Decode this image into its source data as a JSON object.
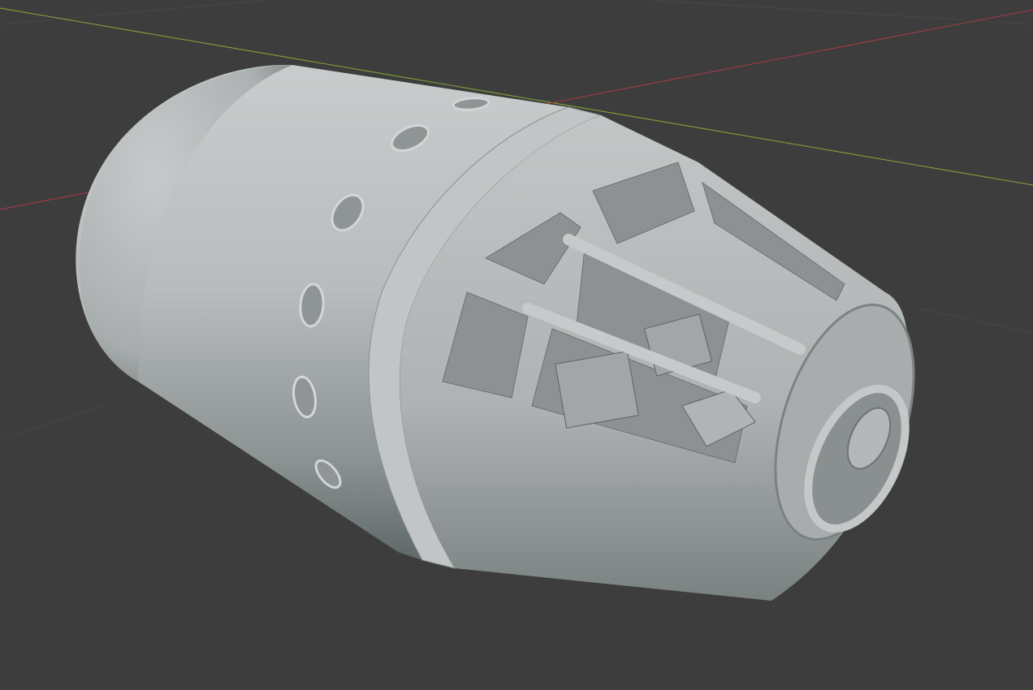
{
  "viewport": {
    "background": "#3d3d3d",
    "grid_color": "#474747",
    "x_axis_color": "#9a3b44",
    "y_axis_color": "#7c9a3b"
  },
  "model": {
    "shading": "solid",
    "base_color": "#b4b8b8",
    "shadow_color": "#6f7777",
    "highlight_color": "#d2d5d5",
    "interior_color": "#8f9393"
  }
}
